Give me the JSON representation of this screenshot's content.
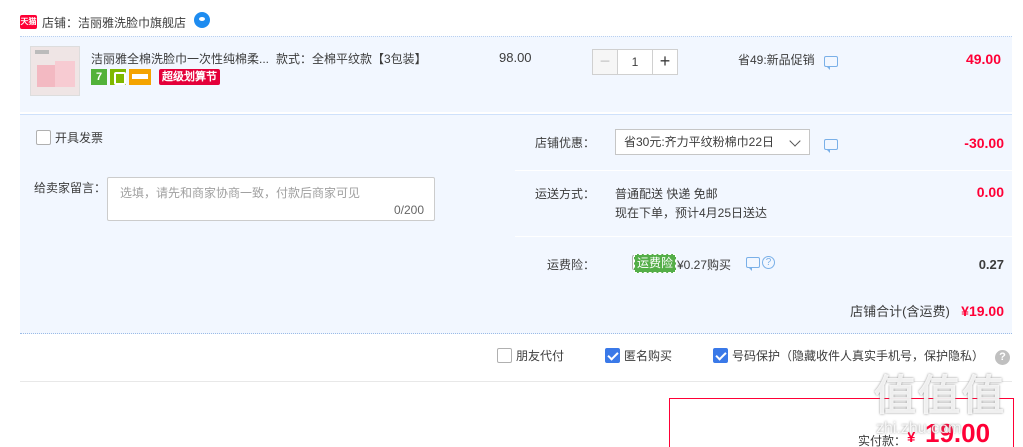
{
  "shop": {
    "tag_label": "天猫",
    "label": "店铺：",
    "name": "洁丽雅洗脸巾旗舰店"
  },
  "item": {
    "title": "洁丽雅全棉洗脸巾一次性纯棉柔...",
    "sku": "款式：全棉平纹款【3包装】",
    "badge_7": "7",
    "promo_badge": "超级划算节",
    "unit_price": "98.00",
    "qty_minus": "−",
    "quantity": "1",
    "qty_plus": "+",
    "promotion": "省49:新品促销",
    "subtotal": "49.00"
  },
  "invoice": {
    "label": "开具发票",
    "checked": false
  },
  "message": {
    "label": "给卖家留言：",
    "placeholder": "选填，请先和商家协商一致，付款后商家可见",
    "counter": "0/200"
  },
  "coupon": {
    "label": "店铺优惠：",
    "selected": "省30元:齐力平纹粉棉巾22日",
    "value": "-30.00"
  },
  "shipping": {
    "label": "运送方式：",
    "method": "普通配送 快递 免邮",
    "eta": "现在下单，预计4月25日送达",
    "value": "0.00"
  },
  "insurance": {
    "label": "运费险：",
    "tag": "运费险",
    "price_text": "¥0.27购买",
    "help_symbol": "?",
    "value": "0.27",
    "checked": false
  },
  "shop_total": {
    "label": "店铺合计(含运费)",
    "value": "¥19.00"
  },
  "options": {
    "friend_pay": {
      "label": "朋友代付",
      "checked": false
    },
    "anonymous": {
      "label": "匿名购买",
      "checked": true
    },
    "number_protect": {
      "label": "号码保护（隐藏收件人真实手机号，保护隐私）",
      "checked": true
    },
    "help_symbol": "?"
  },
  "payment": {
    "label": "实付款：",
    "currency": "¥",
    "amount": "19.00"
  },
  "watermark": {
    "text": "值值值",
    "sub": "zhi.zhu.com"
  },
  "colors": {
    "price_red": "#ff0036",
    "panel_blue": "#f2f7ff",
    "check_blue": "#3a79e8",
    "insurance_green": "#54ae48"
  }
}
